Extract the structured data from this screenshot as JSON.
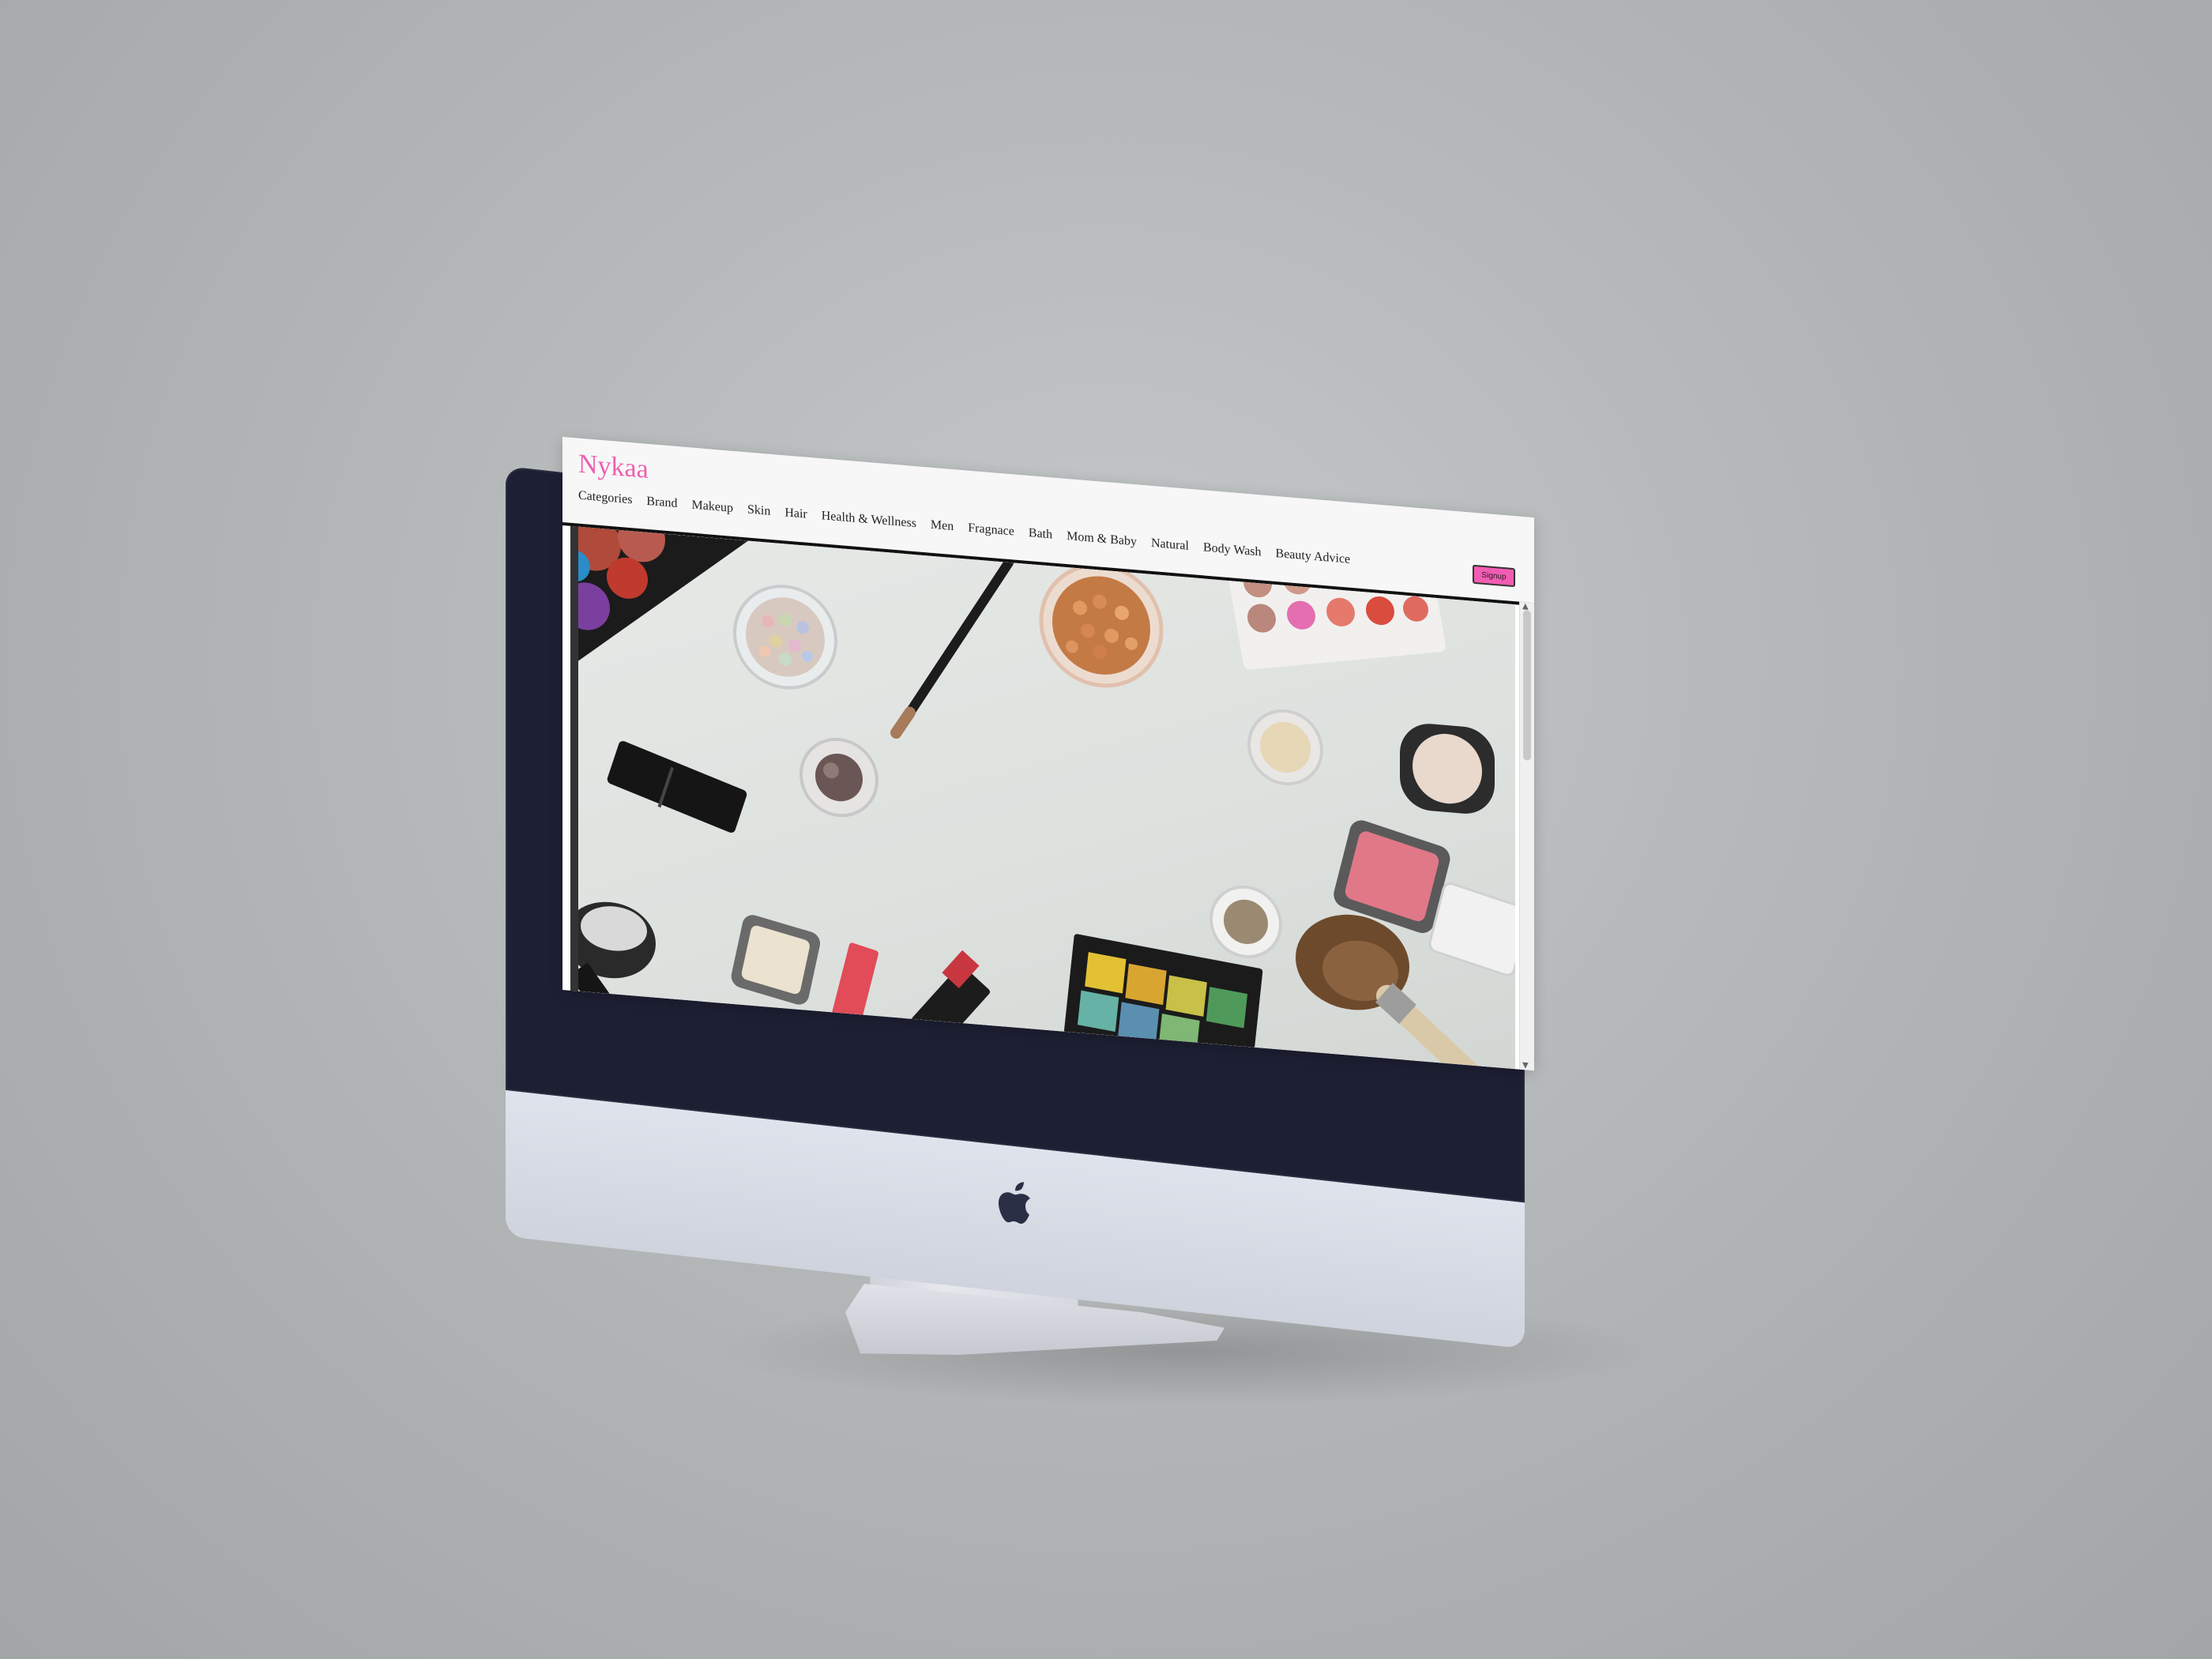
{
  "site": {
    "logo": "Nykaa",
    "nav": [
      "Categories",
      "Brand",
      "Makeup",
      "Skin",
      "Hair",
      "Health & Wellness",
      "Men",
      "Fragnace",
      "Bath",
      "Mom & Baby",
      "Natural",
      "Body Wash",
      "Beauty Advice"
    ],
    "signup_label": "Signup"
  },
  "colors": {
    "brand_pink": "#ee5fae",
    "signup_bg": "#f25cb3",
    "bezel": "#1d1f33"
  },
  "hero": {
    "image": "flat-lay of makeup products on white table"
  }
}
